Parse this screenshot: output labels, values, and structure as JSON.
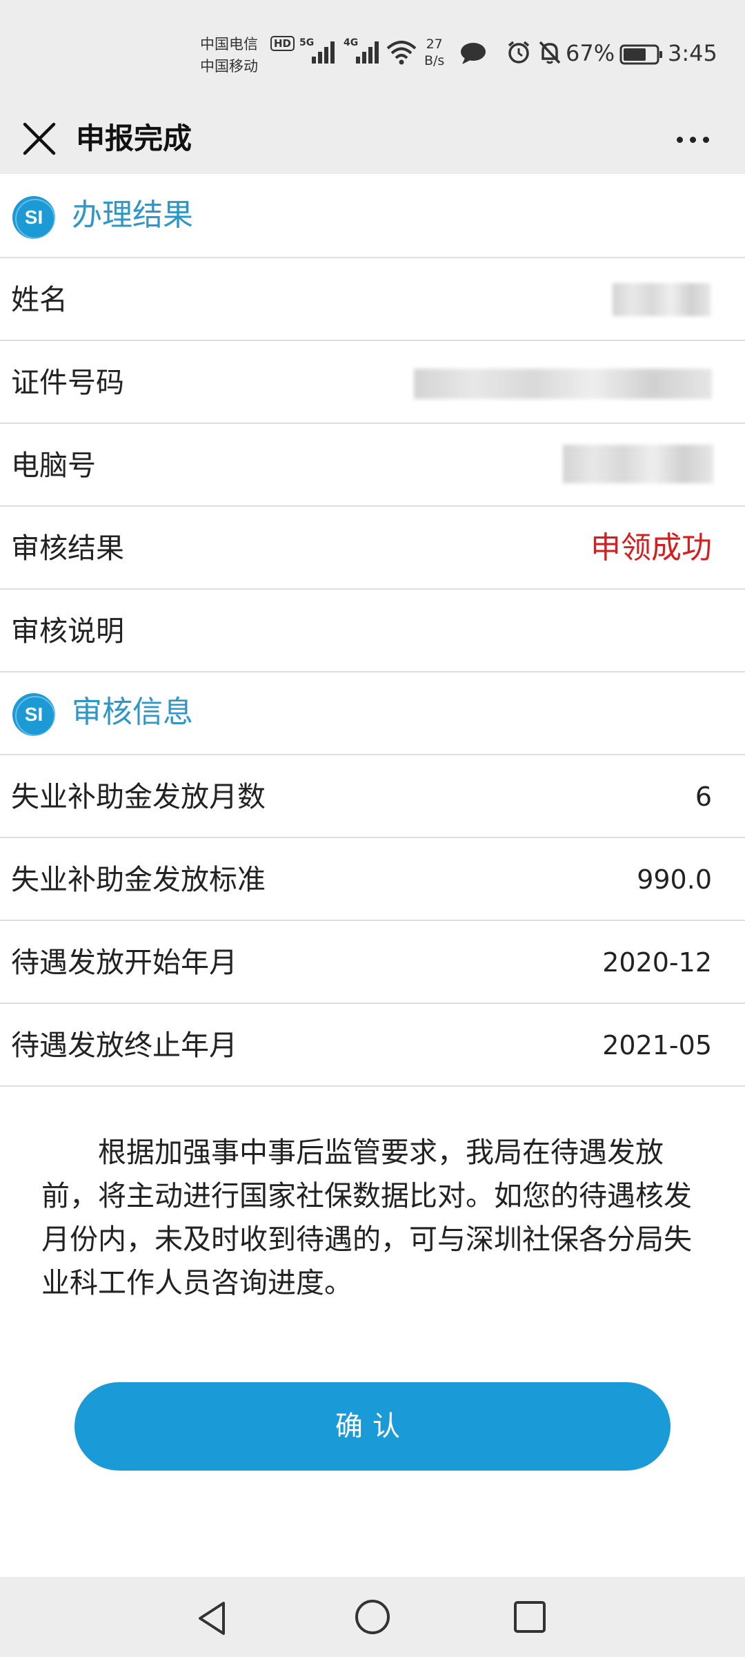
{
  "status_bar": {
    "carrier_1": "中国电信",
    "carrier_2": "中国移动",
    "hd_badge": "HD",
    "network_1": "5G",
    "network_2": "4G",
    "speed_value": "27",
    "speed_unit": "B/s",
    "battery_percent": "67%",
    "time": "3:45",
    "icons": [
      "signal-icon",
      "wifi-icon",
      "chat-icon",
      "alarm-icon",
      "bell-muted-icon",
      "battery-icon"
    ]
  },
  "header": {
    "title": "申报完成",
    "close_icon": "close-icon",
    "more_icon": "more-icon"
  },
  "result_section": {
    "title": "办理结果",
    "icon_text": "SI",
    "rows": [
      {
        "label": "姓名",
        "value": ""
      },
      {
        "label": "证件号码",
        "value": ""
      },
      {
        "label": "电脑号",
        "value": ""
      },
      {
        "label": "审核结果",
        "value": "申领成功"
      },
      {
        "label": "审核说明",
        "value": ""
      }
    ]
  },
  "info_section": {
    "title": "审核信息",
    "icon_text": "SI",
    "rows": [
      {
        "label": "失业补助金发放月数",
        "value": "6"
      },
      {
        "label": "失业补助金发放标准",
        "value": "990.0"
      },
      {
        "label": "待遇发放开始年月",
        "value": "2020-12"
      },
      {
        "label": "待遇发放终止年月",
        "value": "2021-05"
      }
    ]
  },
  "notice": "根据加强事中事后监管要求，我局在待遇发放前，将主动进行国家社保数据比对。如您的待遇核发月份内，未及时收到待遇的，可与深圳社保各分局失业科工作人员咨询进度。",
  "confirm_label": "确认",
  "colors": {
    "accent": "#1a9ad6",
    "section_title": "#2f96c8",
    "success_text": "#d31f1f",
    "bar_background": "#ededed"
  },
  "nav": {
    "back_icon": "back-triangle-icon",
    "home_icon": "home-circle-icon",
    "recent_icon": "recent-square-icon"
  }
}
